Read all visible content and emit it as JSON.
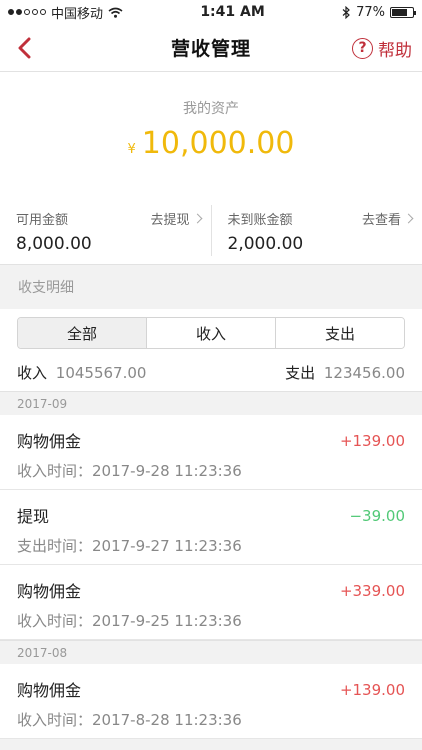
{
  "status_bar": {
    "carrier": "中国移动",
    "time": "1:41 AM",
    "battery": "77%",
    "battery_level": 0.77
  },
  "nav": {
    "title": "营收管理",
    "help_label": "帮助",
    "help_symbol": "?"
  },
  "asset": {
    "label": "我的资产",
    "currency": "¥",
    "value": "10,000.00"
  },
  "available": {
    "label": "可用金额",
    "value": "8,000.00",
    "link": "去提现"
  },
  "pending": {
    "label": "未到账金额",
    "value": "2,000.00",
    "link": "去查看"
  },
  "details_title": "收支明细",
  "tabs": [
    {
      "label": "全部",
      "active": true
    },
    {
      "label": "收入",
      "active": false
    },
    {
      "label": "支出",
      "active": false
    }
  ],
  "totals": {
    "income_label": "收入",
    "income_value": "1045567.00",
    "expense_label": "支出",
    "expense_value": "123456.00"
  },
  "groups": [
    {
      "month": "2017-09",
      "items": [
        {
          "title": "购物佣金",
          "subtitle": "收入时间：2017-9-28 11:23:36",
          "amount": "+139.00",
          "kind": "pos"
        },
        {
          "title": "提现",
          "subtitle": "支出时间：2017-9-27 11:23:36",
          "amount": "−39.00",
          "kind": "neg"
        },
        {
          "title": "购物佣金",
          "subtitle": "收入时间：2017-9-25 11:23:36",
          "amount": "+339.00",
          "kind": "pos"
        }
      ]
    },
    {
      "month": "2017-08",
      "items": [
        {
          "title": "购物佣金",
          "subtitle": "收入时间：2017-8-28 11:23:36",
          "amount": "+139.00",
          "kind": "pos"
        }
      ]
    }
  ]
}
